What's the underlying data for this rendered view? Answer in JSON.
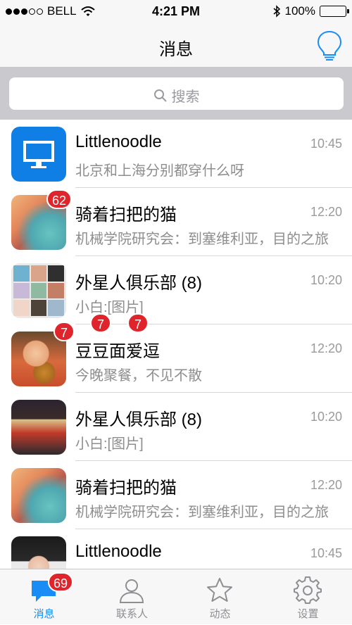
{
  "status": {
    "carrier": "BELL",
    "time": "4:21 PM",
    "battery": "100%"
  },
  "nav": {
    "title": "消息",
    "bulb_icon": "lightbulb-icon"
  },
  "search": {
    "placeholder": "搜索"
  },
  "conversations": [
    {
      "name": "Littlenoodle",
      "time": "10:45",
      "message": "北京和上海分别都穿什么呀",
      "avatar": "monitor-icon"
    },
    {
      "name": "骑着扫把的猫",
      "time": "12:20",
      "message": "机械学院研究会：到塞维利亚，目的之旅",
      "badge": "62"
    },
    {
      "name": "外星人俱乐部 (8)",
      "time": "10:20",
      "message": "小白:[图片]"
    },
    {
      "name": "豆豆面爱逗",
      "time": "12:20",
      "message": "今晚聚餐，不见不散",
      "badges": [
        "7",
        "7",
        "7"
      ]
    },
    {
      "name": "外星人俱乐部 (8)",
      "time": "10:20",
      "message": "小白:[图片]"
    },
    {
      "name": "骑着扫把的猫",
      "time": "12:20",
      "message": "机械学院研究会：到塞维利亚，目的之旅"
    },
    {
      "name": "Littlenoodle",
      "time": "10:45",
      "message": ""
    }
  ],
  "tabs": [
    {
      "label": "消息",
      "badge": "69"
    },
    {
      "label": "联系人"
    },
    {
      "label": "动态"
    },
    {
      "label": "设置"
    }
  ],
  "colors": {
    "accent": "#1a8cf5",
    "badge": "#e0242b",
    "search_bg": "#c9c9ce"
  }
}
